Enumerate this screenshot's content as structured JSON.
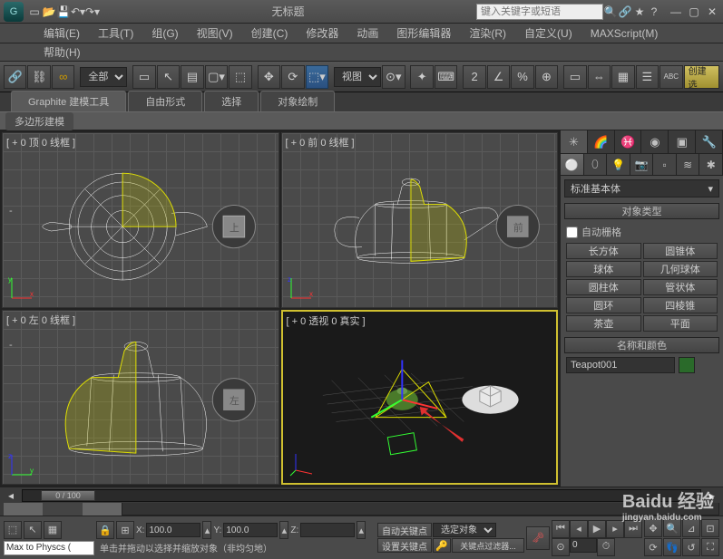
{
  "title": "无标题",
  "search_placeholder": "键入关键字或短语",
  "menus": [
    "编辑(E)",
    "工具(T)",
    "组(G)",
    "视图(V)",
    "创建(C)",
    "修改器",
    "动画",
    "图形编辑器",
    "渲染(R)",
    "自定义(U)",
    "MAXScript(M)"
  ],
  "help_menu": "帮助(H)",
  "toolbar": {
    "selection_set": "全部",
    "ref_coord": "视图",
    "create_btn": "创建选"
  },
  "ribbon": {
    "tabs": [
      "Graphite 建模工具",
      "自由形式",
      "选择",
      "对象绘制"
    ],
    "subtab": "多边形建模"
  },
  "viewports": {
    "top": "[ + 0 顶 0 线框 ]",
    "front": "[ + 0 前 0 线框 ]",
    "left": "[ + 0 左 0 线框 ]",
    "persp": "[ + 0 透视 0 真实 ]",
    "cube_top": "上",
    "cube_front": "前",
    "cube_left": "左"
  },
  "cmd": {
    "category": "标准基本体",
    "rollout_objtype": "对象类型",
    "autogrid": "自动栅格",
    "primitives": [
      "长方体",
      "圆锥体",
      "球体",
      "几何球体",
      "圆柱体",
      "管状体",
      "圆环",
      "四棱锥",
      "茶壶",
      "平面"
    ],
    "rollout_namecolor": "名称和颜色",
    "object_name": "Teapot001"
  },
  "timeline": {
    "frame_label": "0 / 100"
  },
  "status": {
    "script": "Max to Physcs (",
    "x": "100.0",
    "y": "100.0",
    "z": "",
    "prompt": "单击并拖动以选择并缩放对象（非均匀地）",
    "autokey": "自动关键点",
    "setkey": "设置关键点",
    "key_dropdown": "选定对象",
    "keyfilter": "关键点过滤器..."
  },
  "watermark": {
    "brand": "Baidu 经验",
    "url": "jingyan.baidu.com"
  }
}
